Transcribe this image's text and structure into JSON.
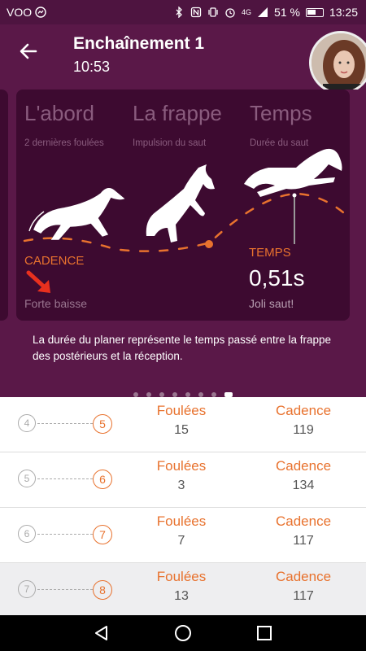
{
  "status": {
    "carrier": "VOO",
    "battery": "51 %",
    "time": "13:25",
    "signal": "4G"
  },
  "header": {
    "title": "Enchaînement 1",
    "subtitle": "10:53"
  },
  "card": {
    "columns": [
      {
        "title": "L'abord",
        "sub": "2 dernières foulées"
      },
      {
        "title": "La frappe",
        "sub": "Impulsion du saut"
      },
      {
        "title": "Temps",
        "sub": "Durée du saut"
      }
    ],
    "cadence_label": "CADENCE",
    "cadence_status": "Forte baisse",
    "temps_label": "TEMPS",
    "temps_value": "0,51s",
    "temps_comment": "Joli saut!"
  },
  "description": "La durée du planer représente le temps passé entre la frappe des postérieurs et la réception.",
  "pager": {
    "count": 8,
    "active": 7
  },
  "rows": [
    {
      "from": "4",
      "to": "5",
      "label1": "Foulées",
      "val1": "15",
      "label2": "Cadence",
      "val2": "119"
    },
    {
      "from": "5",
      "to": "6",
      "label1": "Foulées",
      "val1": "3",
      "label2": "Cadence",
      "val2": "134"
    },
    {
      "from": "6",
      "to": "7",
      "label1": "Foulées",
      "val1": "7",
      "label2": "Cadence",
      "val2": "117"
    },
    {
      "from": "7",
      "to": "8",
      "label1": "Foulées",
      "val1": "13",
      "label2": "Cadence",
      "val2": "117"
    }
  ],
  "colors": {
    "accent": "#e8722e",
    "header": "#5a1848",
    "card": "#3d0a30"
  },
  "icons": [
    "back-arrow-icon",
    "nav-back-icon",
    "nav-home-icon",
    "nav-recents-icon"
  ]
}
